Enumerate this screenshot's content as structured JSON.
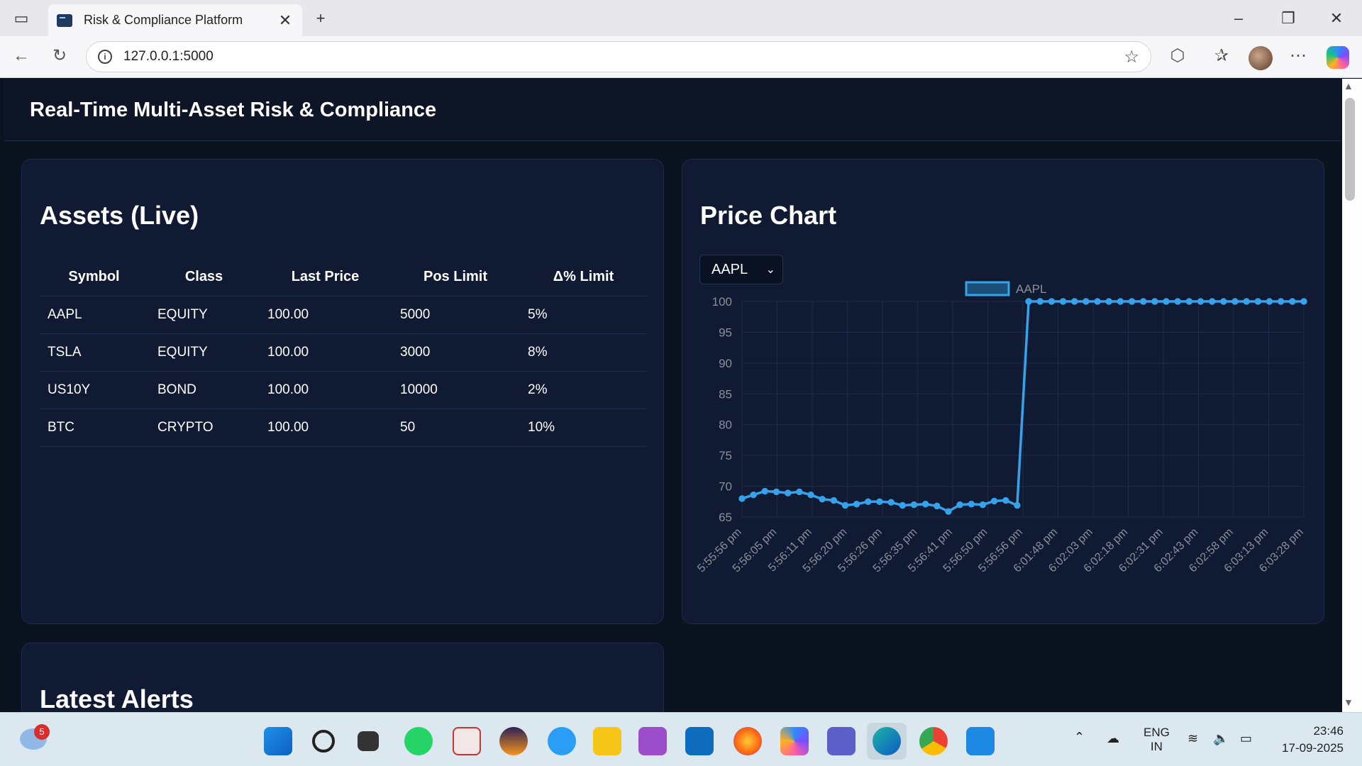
{
  "browser": {
    "tab_title": "Risk & Compliance Platform",
    "url": "127.0.0.1:5000"
  },
  "page": {
    "title": "Real-Time Multi-Asset Risk & Compliance"
  },
  "assets": {
    "heading": "Assets (Live)",
    "columns": [
      "Symbol",
      "Class",
      "Last Price",
      "Pos Limit",
      "Δ% Limit"
    ],
    "rows": [
      [
        "AAPL",
        "EQUITY",
        "100.00",
        "5000",
        "5%"
      ],
      [
        "TSLA",
        "EQUITY",
        "100.00",
        "3000",
        "8%"
      ],
      [
        "US10Y",
        "BOND",
        "100.00",
        "10000",
        "2%"
      ],
      [
        "BTC",
        "CRYPTO",
        "100.00",
        "50",
        "10%"
      ]
    ]
  },
  "price_chart": {
    "heading": "Price Chart",
    "selected_symbol": "AAPL"
  },
  "alerts": {
    "heading": "Latest Alerts"
  },
  "chart_data": {
    "type": "line",
    "legend": [
      "AAPL"
    ],
    "legend_position": "top-center",
    "series": [
      {
        "name": "AAPL",
        "values": [
          68,
          68.6,
          69.2,
          69.1,
          68.9,
          69.1,
          68.6,
          67.9,
          67.7,
          66.9,
          67.1,
          67.5,
          67.5,
          67.4,
          66.9,
          67,
          67.1,
          66.8,
          65.9,
          67,
          67.1,
          67,
          67.6,
          67.7,
          66.9,
          100,
          100,
          100,
          100,
          100,
          100,
          100,
          100,
          100,
          100,
          100,
          100,
          100,
          100,
          100,
          100,
          100,
          100,
          100,
          100,
          100,
          100,
          100,
          100,
          100
        ]
      }
    ],
    "x_tick_labels": [
      "5:55:56 pm",
      "5:56:05 pm",
      "5:56:11 pm",
      "5:56:20 pm",
      "5:56:26 pm",
      "5:56:35 pm",
      "5:56:41 pm",
      "5:56:50 pm",
      "5:56:56 pm",
      "6:01:48 pm",
      "6:02:03 pm",
      "6:02:18 pm",
      "6:02:31 pm",
      "6:02:43 pm",
      "6:02:58 pm",
      "6:03:13 pm",
      "6:03:28 pm"
    ],
    "y_ticks": [
      65,
      70,
      75,
      80,
      85,
      90,
      95,
      100
    ],
    "ylim": [
      65,
      100
    ],
    "grid": true,
    "line_color": "#36a2eb"
  },
  "taskbar": {
    "notif_count": "5",
    "lang_line1": "ENG",
    "lang_line2": "IN",
    "time": "23:46",
    "date": "17-09-2025"
  }
}
